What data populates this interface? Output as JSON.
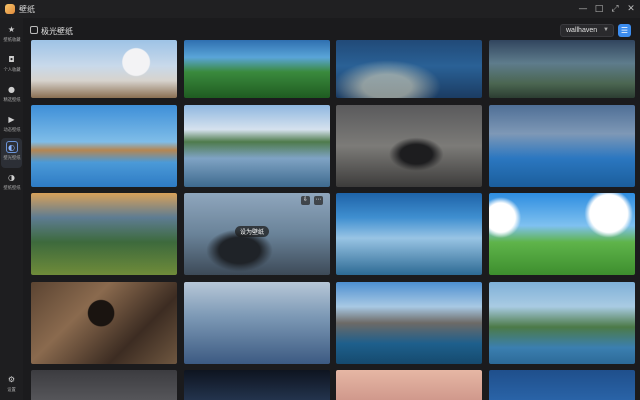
{
  "app": {
    "title": "壁纸"
  },
  "window_controls": [
    "—",
    "□",
    "⤢",
    "✕"
  ],
  "sidebar": {
    "items": [
      {
        "label": "壁纸收藏",
        "icon": "star-icon"
      },
      {
        "label": "个人收藏",
        "icon": "folder-icon"
      },
      {
        "label": "精选壁纸",
        "icon": "circle-icon"
      },
      {
        "label": "动态壁纸",
        "icon": "play-icon"
      },
      {
        "label": "壁光壁纸",
        "icon": "palette-icon",
        "active": true
      },
      {
        "label": "壁纸壁纸",
        "icon": "palette-icon"
      }
    ],
    "settings_label": "设置"
  },
  "header": {
    "title": "极光壁纸"
  },
  "source_select": {
    "value": "wallhaven"
  },
  "thumbnail_overlay": {
    "badge": "设为壁纸"
  },
  "colors": {
    "accent": "#3c8df0",
    "background": "#1b1b1d"
  }
}
